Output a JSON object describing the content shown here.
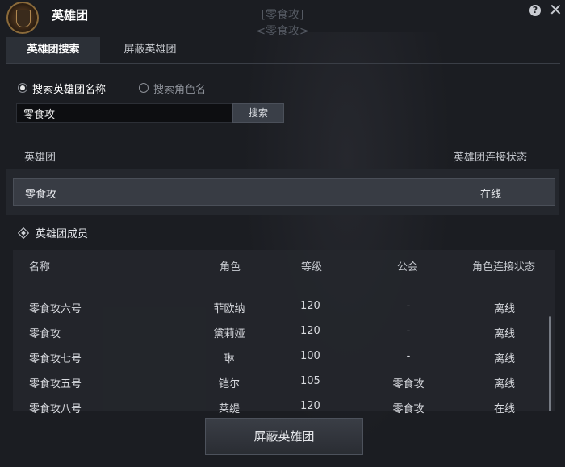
{
  "header": {
    "title": "英雄团",
    "help_label": "?",
    "close_label": "✕"
  },
  "background": {
    "line1": "[零食攻]",
    "line2": "<零食攻>"
  },
  "tabs": [
    {
      "label": "英雄团搜索",
      "active": true
    },
    {
      "label": "屏蔽英雄团",
      "active": false
    }
  ],
  "search_options": [
    {
      "label": "搜索英雄团名称",
      "checked": true
    },
    {
      "label": "搜索角色名",
      "checked": false
    }
  ],
  "search": {
    "value": "零食攻",
    "button_label": "搜索"
  },
  "guild_table": {
    "headers": {
      "name": "英雄团",
      "status": "英雄团连接状态"
    },
    "row": {
      "name": "零食攻",
      "status": "在线"
    }
  },
  "members_section": {
    "title": "英雄团成员"
  },
  "members_table": {
    "headers": [
      "名称",
      "角色",
      "等级",
      "公会",
      "角色连接状态"
    ],
    "rows": [
      [
        "零食攻六号",
        "菲欧纳",
        "120",
        "-",
        "离线"
      ],
      [
        "零食攻",
        "黛莉娅",
        "120",
        "-",
        "离线"
      ],
      [
        "零食攻七号",
        "琳",
        "100",
        "-",
        "离线"
      ],
      [
        "零食攻五号",
        "铠尔",
        "105",
        "零食攻",
        "离线"
      ],
      [
        "零食攻八号",
        "莱缇",
        "120",
        "零食攻",
        "在线"
      ]
    ]
  },
  "footer": {
    "block_button_label": "屏蔽英雄团"
  },
  "colors": {
    "background": "#1b1d22",
    "panel": "#24272d",
    "selected_row": "#383c44",
    "text": "#d6d8dc"
  }
}
